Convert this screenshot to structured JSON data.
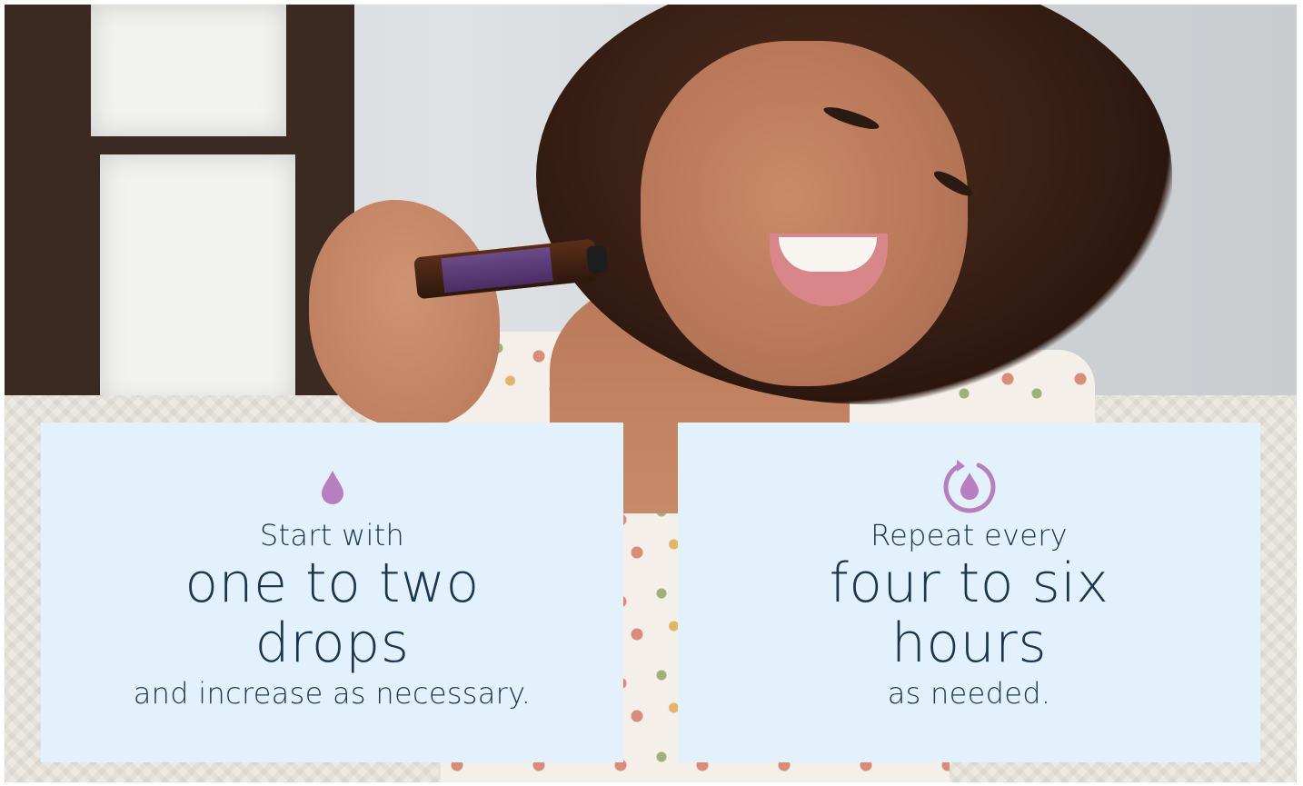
{
  "accent_color": "#b77fc0",
  "text_color": "#1d3550",
  "card_background": "#e2f1fb",
  "cards": [
    {
      "icon": "drop-icon",
      "intro": "Start with",
      "headline_1": "one to two",
      "headline_2": "drops",
      "outro": "and increase as necessary."
    },
    {
      "icon": "repeat-drop-icon",
      "intro": "Repeat every",
      "headline_1": "four to six",
      "headline_2": "hours",
      "outro": "as needed."
    }
  ]
}
